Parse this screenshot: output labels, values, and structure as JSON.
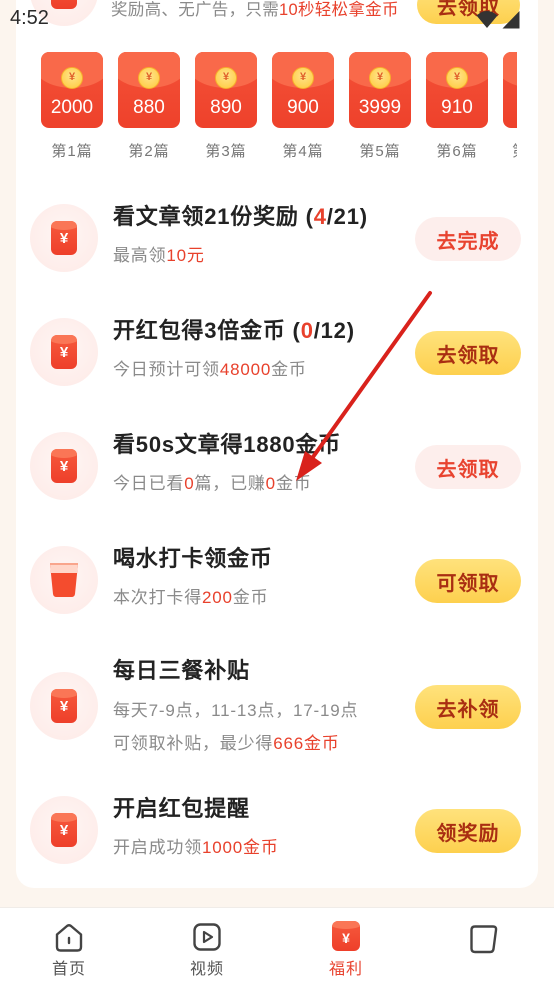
{
  "status_bar": {
    "time": "4:52",
    "wifi_icon": "wifi-icon",
    "signal_icon": "cellular-signal-icon"
  },
  "currency_symbol": "¥",
  "colors": {
    "page_bg": "#fcf5ee",
    "card_bg": "#ffffff",
    "accent_red": "#e8412c",
    "text_dark": "#222222",
    "text_gray": "#8a8a8a",
    "button_yellow": "#fdd04e",
    "button_yellow_text": "#a92e12",
    "button_pink": "#fdeeec",
    "envelope_red": "#ee412b",
    "coin_gold": "#ffc93a",
    "annotation_arrow": "#d9221c"
  },
  "top_partial_task": {
    "icon": "red-envelope-icon",
    "subtitle": [
      "奖励高、无广告，只需",
      "10秒轻松拿金币"
    ],
    "button_label": "去领取"
  },
  "envelopes": [
    {
      "amount": "2000",
      "label": "第1篇"
    },
    {
      "amount": "880",
      "label": "第2篇"
    },
    {
      "amount": "890",
      "label": "第3篇"
    },
    {
      "amount": "900",
      "label": "第4篇"
    },
    {
      "amount": "3999",
      "label": "第5篇"
    },
    {
      "amount": "910",
      "label": "第6篇"
    },
    {
      "label": "第"
    }
  ],
  "tasks": [
    {
      "icon": "red-envelope-icon",
      "title": [
        "看文章领21份奖励 (",
        "4",
        "/21)"
      ],
      "subtitle": [
        "最高领",
        "10元"
      ],
      "button": "去完成",
      "button_bg": "#fdeeec"
    },
    {
      "icon": "red-envelope-icon",
      "title": [
        "开红包得3倍金币 (",
        "0",
        "/12)"
      ],
      "subtitle": [
        "今日预计可领",
        "48000",
        "金币"
      ],
      "button": "去领取",
      "button_bg": "#fdd04e"
    },
    {
      "icon": "red-envelope-icon",
      "title": [
        "看50s文章得1880金币"
      ],
      "subtitle": [
        "今日已看",
        "0",
        "篇，已赚",
        "0",
        "金币"
      ],
      "button": "去领取",
      "button_bg": "#fdeeec"
    },
    {
      "icon": "water-cup-icon",
      "title": [
        "喝水打卡领金币"
      ],
      "subtitle": [
        "本次打卡得",
        "200",
        "金币"
      ],
      "button": "可领取",
      "button_bg": "#fdd04e"
    },
    {
      "icon": "red-envelope-icon",
      "title": [
        "每日三餐补贴"
      ],
      "subtitle": [
        "每天7-9点，11-13点，17-19点"
      ],
      "subtitle_line2": [
        "可领取补贴，最少得",
        "666金币"
      ],
      "button": "去补领",
      "button_bg": "#fdd04e"
    },
    {
      "icon": "red-envelope-icon",
      "title": [
        "开启红包提醒"
      ],
      "subtitle": [
        "开启成功领",
        "1000金币"
      ],
      "button": "领奖励",
      "button_bg": "#fdd04e"
    }
  ],
  "bottom_nav": [
    {
      "label": "首页",
      "icon": "home-icon",
      "active": false
    },
    {
      "label": "视频",
      "icon": "video-icon",
      "active": false
    },
    {
      "label": "福利",
      "icon": "welfare-yuan-icon",
      "active": true
    },
    {
      "icon": "tab-card-icon",
      "active": false
    }
  ]
}
